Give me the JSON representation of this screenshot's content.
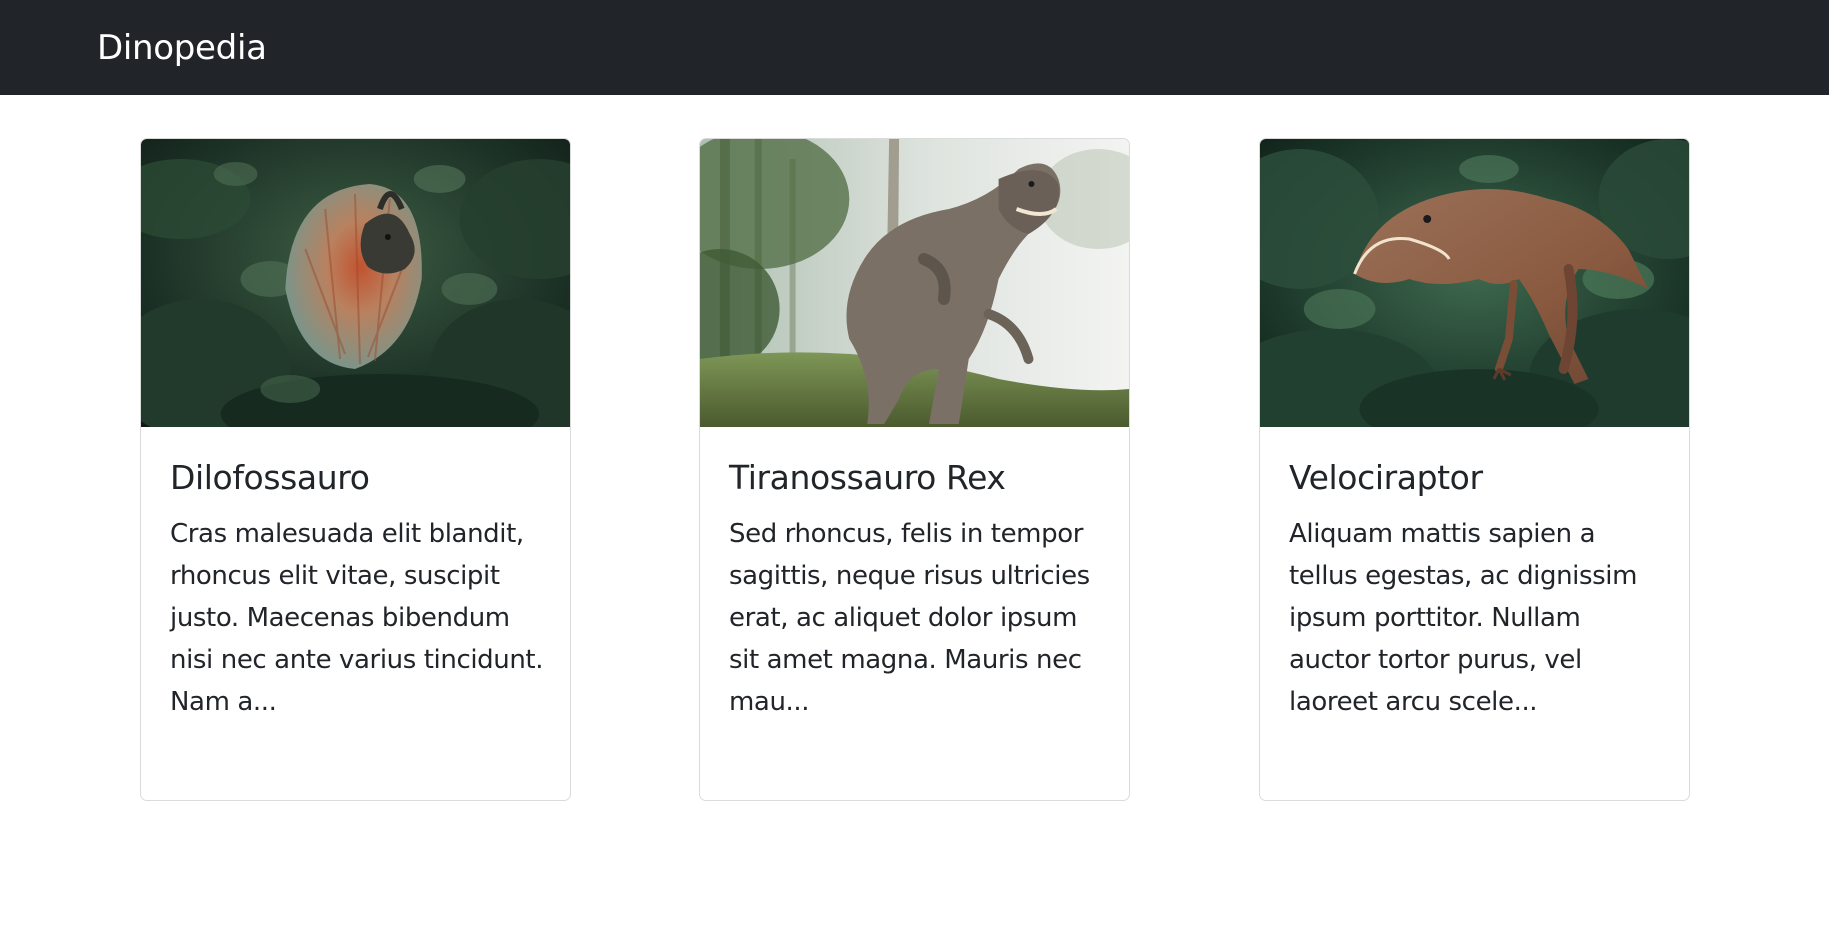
{
  "navbar": {
    "brand": "Dinopedia",
    "background": "#212529"
  },
  "cards": [
    {
      "title": "Dilofossauro",
      "text": "Cras malesuada elit blandit, rhoncus elit vitae, suscipit justo. Maecenas bibendum nisi nec ante varius tincidunt. Nam a...",
      "image": "dilophosaurus-photo"
    },
    {
      "title": "Tiranossauro Rex",
      "text": "Sed rhoncus, felis in tempor sagittis, neque risus ultricies erat, ac aliquet dolor ipsum sit amet magna. Mauris nec mau...",
      "image": "tyrannosaurus-photo"
    },
    {
      "title": "Velociraptor",
      "text": "Aliquam mattis sapien a tellus egestas, ac dignissim ipsum porttitor. Nullam auctor tortor purus, vel laoreet arcu scele...",
      "image": "velociraptor-photo"
    }
  ]
}
